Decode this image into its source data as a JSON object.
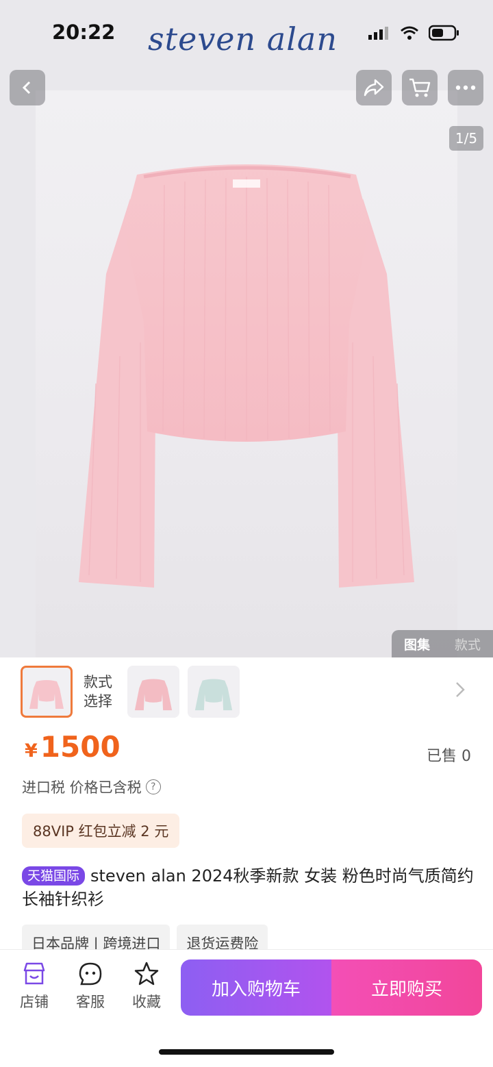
{
  "status_bar": {
    "time": "20:22",
    "brand_logo": "steven alan"
  },
  "gallery": {
    "counter": "1/5",
    "tabs": [
      {
        "label": "图集",
        "active": true
      },
      {
        "label": "款式",
        "active": false
      }
    ]
  },
  "variants": {
    "label": "款式选择",
    "items": [
      "pink-sweater",
      "pink-sweater-alt",
      "mint-sweater"
    ],
    "selected_index": 0
  },
  "price": {
    "currency": "¥",
    "value": "1500"
  },
  "sold": "已售 0",
  "tax": {
    "text": "进口税 价格已含税",
    "help_icon": "?"
  },
  "promo": "88VIP 红包立减 2 元",
  "title": {
    "badge": "天猫国际",
    "text": "steven alan 2024秋季新款 女装 粉色时尚气质简约长袖针织衫"
  },
  "tags": [
    "日本品牌 | 跨境进口",
    "退货运费险"
  ],
  "bottom_nav": [
    {
      "label": "店铺",
      "icon": "store-icon"
    },
    {
      "label": "客服",
      "icon": "chat-face-icon"
    },
    {
      "label": "收藏",
      "icon": "star-icon"
    }
  ],
  "actions": {
    "add_to_cart": "加入购物车",
    "buy_now": "立即购买"
  },
  "colors": {
    "price": "#f0631c",
    "tmall": "#7a48e6",
    "cart_gradient": "#8d5ff2",
    "buy_gradient": "#f34fb6",
    "selected_border": "#ef7a3c"
  }
}
